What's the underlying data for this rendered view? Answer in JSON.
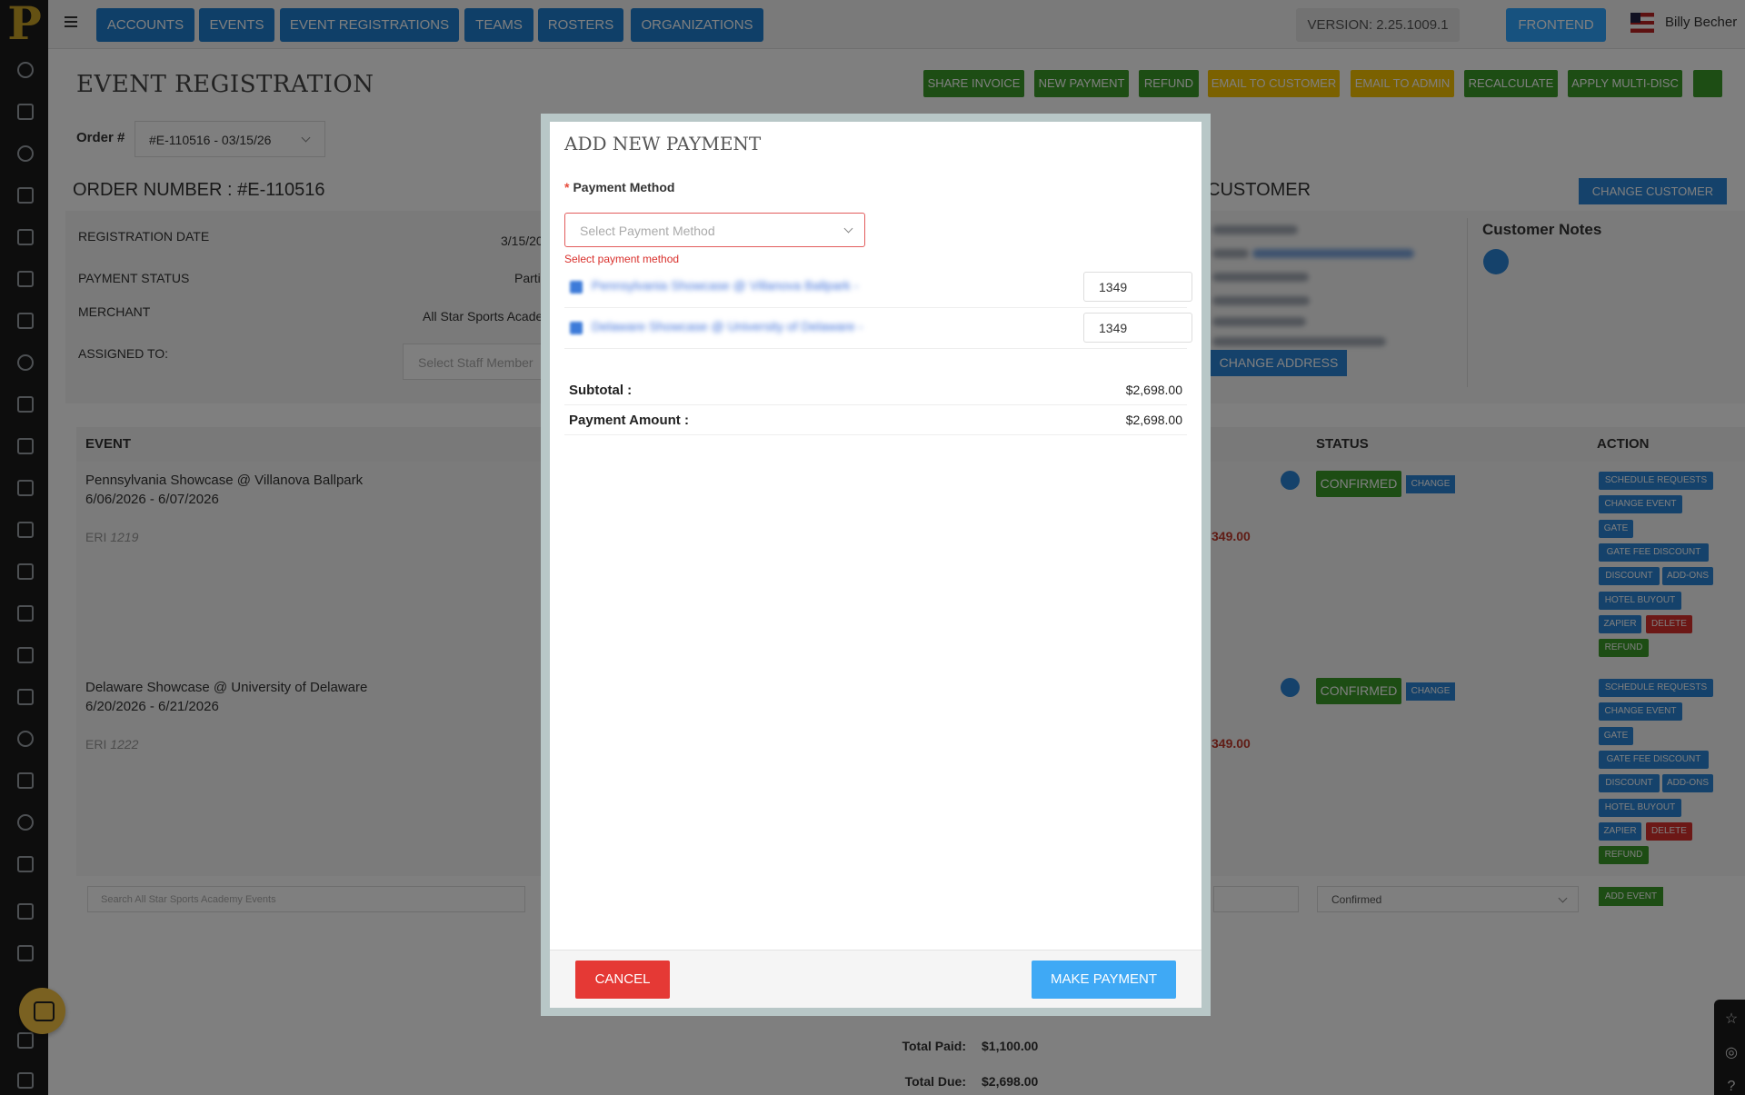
{
  "colors": {
    "primary": "#1f7fd0",
    "success": "#3a9b28",
    "warning": "#f6c300",
    "danger": "#d9302c",
    "accent": "#2ea4ff"
  },
  "topbar": {
    "nav": [
      "ACCOUNTS",
      "EVENTS",
      "EVENT REGISTRATIONS",
      "TEAMS",
      "ROSTERS",
      "ORGANIZATIONS"
    ],
    "version": "VERSION: 2.25.1009.1",
    "frontend": "FRONTEND",
    "user": "Billy Becher"
  },
  "page": {
    "title": "EVENT REGISTRATION",
    "actions": [
      "SHARE INVOICE",
      "NEW PAYMENT",
      "REFUND",
      "EMAIL TO CUSTOMER",
      "EMAIL TO ADMIN",
      "RECALCULATE",
      "APPLY MULTI-DISC"
    ],
    "order_label": "Order #",
    "order_value": "#E-110516 - 03/15/26"
  },
  "order": {
    "heading": "ORDER NUMBER : #E-110516",
    "registration_date_label": "REGISTRATION DATE",
    "registration_date_value": "3/15/20",
    "payment_status_label": "PAYMENT STATUS",
    "payment_status_value": "Parti",
    "merchant_label": "MERCHANT",
    "merchant_value": "All Star Sports Acade",
    "assigned_label": "ASSIGNED TO:",
    "assigned_placeholder": "Select Staff Member"
  },
  "customer": {
    "heading": "CUSTOMER",
    "change_customer": "CHANGE CUSTOMER",
    "change_address": "CHANGE ADDRESS",
    "notes_title": "Customer Notes"
  },
  "events": {
    "headers": {
      "event": "EVENT",
      "status": "STATUS",
      "action": "ACTION"
    },
    "rows": [
      {
        "name": "Pennsylvania Showcase @ Villanova Ballpark",
        "dates": "6/06/2026 - 6/07/2026",
        "eri_label": "ERI",
        "eri": "1219",
        "price": "349.00",
        "status": "CONFIRMED",
        "change": "CHANGE"
      },
      {
        "name": "Delaware Showcase @ University of Delaware",
        "dates": "6/20/2026 - 6/21/2026",
        "eri_label": "ERI",
        "eri": "1222",
        "price": "349.00",
        "status": "CONFIRMED",
        "change": "CHANGE"
      }
    ],
    "row_actions": {
      "schedule": "SCHEDULE REQUESTS",
      "change_event": "CHANGE EVENT",
      "gate": "GATE",
      "gate_fee": "GATE FEE DISCOUNT",
      "discount": "DISCOUNT",
      "addons": "ADD-ONS",
      "hotel": "HOTEL BUYOUT",
      "zapier": "ZAPIER",
      "delete": "DELETE",
      "refund": "REFUND"
    },
    "search_placeholder": "Search All Star Sports Academy Events",
    "status_default": "Confirmed",
    "add_event": "ADD EVENT"
  },
  "totals": {
    "paid_label": "Total Paid:",
    "paid_value": "$1,100.00",
    "due_label": "Total Due:",
    "due_value": "$2,698.00"
  },
  "modal": {
    "title": "ADD NEW PAYMENT",
    "required_mark": "*",
    "method_label": "Payment Method",
    "method_placeholder": "Select Payment Method",
    "method_error": "Select payment method",
    "items": [
      {
        "name": "Pennsylvania Showcase @ Villanova Ballpark -",
        "amount": "1349"
      },
      {
        "name": "Delaware Showcase @ University of Delaware -",
        "amount": "1349"
      }
    ],
    "subtotal_label": "Subtotal :",
    "subtotal_value": "$2,698.00",
    "amount_label": "Payment Amount :",
    "amount_value": "$2,698.00",
    "cancel": "CANCEL",
    "submit": "MAKE PAYMENT"
  }
}
